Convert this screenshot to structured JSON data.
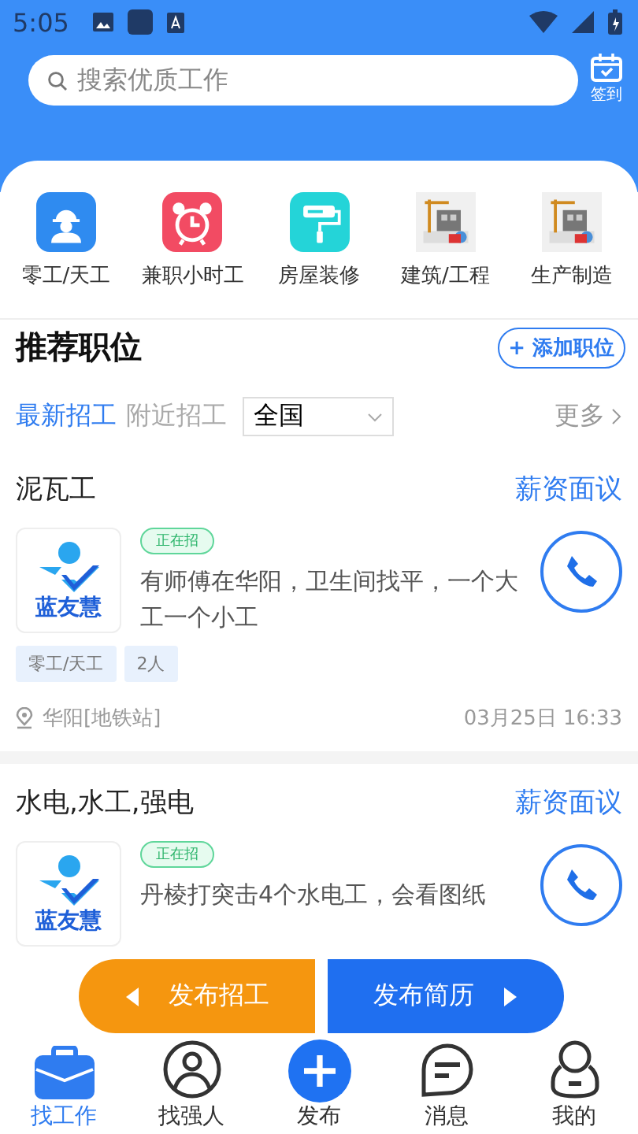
{
  "status_bar": {
    "time": "5:05"
  },
  "search": {
    "placeholder": "搜索优质工作"
  },
  "checkin": {
    "label": "签到"
  },
  "categories": [
    {
      "label": "零工/天工",
      "kind": "worker"
    },
    {
      "label": "兼职小时工",
      "kind": "clock"
    },
    {
      "label": "房屋装修",
      "kind": "roller"
    },
    {
      "label": "建筑/工程",
      "kind": "picture"
    },
    {
      "label": "生产制造",
      "kind": "picture"
    }
  ],
  "section": {
    "title": "推荐职位",
    "add_button": "+ 添加职位"
  },
  "filters": {
    "tabs": [
      {
        "label": "最新招工",
        "selected": true
      },
      {
        "label": "附近招工",
        "selected": false
      }
    ],
    "region": "全国",
    "more": "更多"
  },
  "jobs": [
    {
      "title": "泥瓦工",
      "salary": "薪资面议",
      "logo_text": "蓝友慧",
      "status": "正在招",
      "description": "有师傅在华阳，卫生间找平，一个大工一个小工",
      "tags": [
        "零工/天工",
        "2人"
      ],
      "location": "华阳[地铁站]",
      "time": "03月25日 16:33"
    },
    {
      "title": "水电,水工,强电",
      "salary": "薪资面议",
      "logo_text": "蓝友慧",
      "status": "正在招",
      "description": "丹棱打突击4个水电工，会看图纸"
    }
  ],
  "floating": {
    "left": "发布招工",
    "right": "发布简历"
  },
  "nav": [
    {
      "label": "找工作",
      "kind": "briefcase",
      "selected": true
    },
    {
      "label": "找强人",
      "kind": "person",
      "selected": false
    },
    {
      "label": "发布",
      "kind": "plus",
      "selected": false
    },
    {
      "label": "消息",
      "kind": "chat",
      "selected": false
    },
    {
      "label": "我的",
      "kind": "me",
      "selected": false
    }
  ]
}
